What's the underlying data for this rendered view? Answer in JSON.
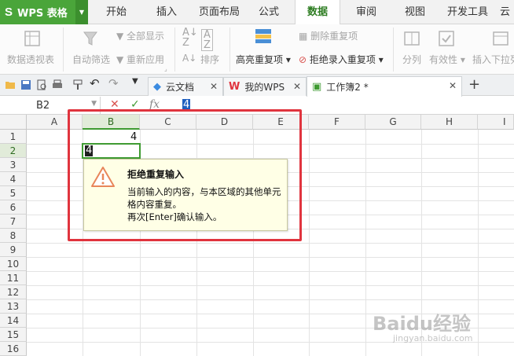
{
  "menubar": {
    "app_logo": "S",
    "app_title": "WPS 表格",
    "tabs": [
      "开始",
      "插入",
      "页面布局",
      "公式",
      "数据",
      "审阅",
      "视图",
      "开发工具",
      "云"
    ],
    "active_tab": "数据"
  },
  "ribbon": {
    "pivot": "数据透视表",
    "autofilter": "自动筛选",
    "show_all": "全部显示",
    "reapply": "重新应用",
    "sort": "排序",
    "highlight_dup": "高亮重复项",
    "remove_dup": "删除重复项",
    "reject_dup": "拒绝录入重复项",
    "split": "分列",
    "validity": "有效性",
    "insert_dropdown": "插入下拉列"
  },
  "docbar": {
    "tabs": [
      {
        "label": "云文档",
        "icon": "cloud-doc-icon"
      },
      {
        "label": "我的WPS",
        "icon": "wps-logo-icon"
      },
      {
        "label": "工作簿2 *",
        "icon": "spreadsheet-icon"
      }
    ],
    "new_tab": "+"
  },
  "formulabar": {
    "name_box": "B2",
    "fx": "fx",
    "cancel": "✕",
    "confirm": "✓",
    "value": "4"
  },
  "grid": {
    "columns": [
      "A",
      "B",
      "C",
      "D",
      "E",
      "F",
      "G",
      "H",
      "I"
    ],
    "rows": [
      "1",
      "2",
      "3",
      "4",
      "5",
      "6",
      "7",
      "8",
      "9",
      "10",
      "11",
      "12",
      "13",
      "14",
      "15",
      "16"
    ],
    "b1": "4",
    "b2_editing": "4"
  },
  "tooltip": {
    "title": "拒绝重复输入",
    "line1": "当前输入的内容，与本区域的其他单元",
    "line2": "格内容重复。",
    "line3": "再次[Enter]确认输入。"
  },
  "watermark": {
    "brand": "Baidu经验",
    "url": "jingyan.baidu.com"
  },
  "colors": {
    "accent_green": "#4aa53a",
    "highlight_red": "#e0343e",
    "tooltip_bg": "#ffffe6"
  }
}
